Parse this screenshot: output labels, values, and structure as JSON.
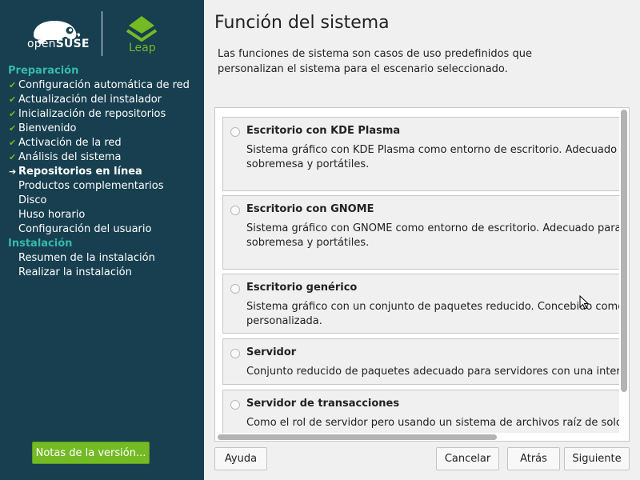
{
  "sidebar": {
    "brand": {
      "opensuse_prefix": "open",
      "opensuse_suffix": "SUSE",
      "leap": "Leap"
    },
    "sections": [
      {
        "title": "Preparación",
        "steps": [
          {
            "label": "Configuración automática de red",
            "state": "done"
          },
          {
            "label": "Actualización del instalador",
            "state": "done"
          },
          {
            "label": "Inicialización de repositorios",
            "state": "done"
          },
          {
            "label": "Bienvenido",
            "state": "done"
          },
          {
            "label": "Activación de la red",
            "state": "done"
          },
          {
            "label": "Análisis del sistema",
            "state": "done"
          },
          {
            "label": "Repositorios en línea",
            "state": "current"
          },
          {
            "label": "Productos complementarios",
            "state": "pending"
          },
          {
            "label": "Disco",
            "state": "pending"
          },
          {
            "label": "Huso horario",
            "state": "pending"
          },
          {
            "label": "Configuración del usuario",
            "state": "pending"
          }
        ]
      },
      {
        "title": "Instalación",
        "steps": [
          {
            "label": "Resumen de la instalación",
            "state": "pending"
          },
          {
            "label": "Realizar la instalación",
            "state": "pending"
          }
        ]
      }
    ],
    "release_notes_label": "Notas de la versión..."
  },
  "main": {
    "title": "Función del sistema",
    "description": "Las funciones de sistema son casos de uso predefinidos que personalizan el sistema para el escenario seleccionado.",
    "roles": [
      {
        "name": "Escritorio con KDE Plasma",
        "description_lines": [
          "Sistema gráfico con KDE Plasma como entorno de escritorio. Adecuado para esta",
          "sobremesa y portátiles."
        ]
      },
      {
        "name": "Escritorio con GNOME",
        "description_lines": [
          "Sistema gráfico con GNOME como entorno de escritorio. Adecuado para estacion",
          "sobremesa y portátiles."
        ]
      },
      {
        "name": "Escritorio genérico",
        "description_lines": [
          "Sistema gráfico con un conjunto de paquetes reducido. Concebido como base",
          "personalizada."
        ]
      },
      {
        "name": "Servidor",
        "description_lines": [
          "Conjunto reducido de paquetes adecuado para servidores con una interfaz en m"
        ]
      },
      {
        "name": "Servidor de transacciones",
        "description_lines": [
          "Como el rol de servidor pero usando un sistema de archivos raíz de solo lectura p"
        ]
      }
    ]
  },
  "buttons": {
    "help": "Ayuda",
    "cancel": "Cancelar",
    "back": "Atrás",
    "next": "Siguiente"
  },
  "colors": {
    "sidebar_bg": "#173f4f",
    "accent_green": "#73ba25",
    "section_teal": "#35b9ab"
  }
}
